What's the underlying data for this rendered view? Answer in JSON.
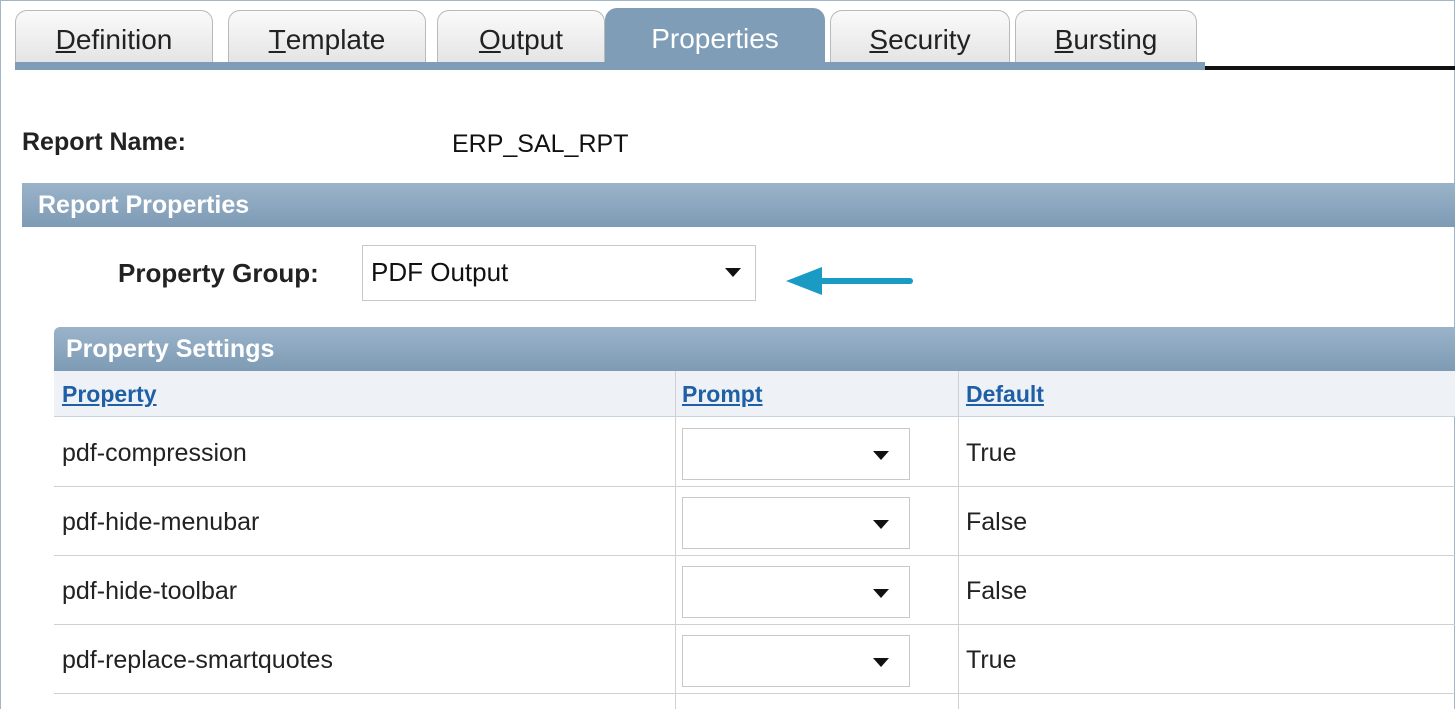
{
  "tabs": [
    {
      "label": "Definition",
      "accel": "D",
      "rest": "efinition",
      "active": false
    },
    {
      "label": "Template",
      "accel": "T",
      "rest": "emplate",
      "active": false
    },
    {
      "label": "Output",
      "accel": "O",
      "rest": "utput",
      "active": false
    },
    {
      "label": "Properties",
      "accel": "",
      "rest": "Properties",
      "active": true
    },
    {
      "label": "Security",
      "accel": "S",
      "rest": "ecurity",
      "active": false
    },
    {
      "label": "Bursting",
      "accel": "B",
      "rest": "ursting",
      "active": false
    }
  ],
  "report": {
    "name_label": "Report Name:",
    "name_value": "ERP_SAL_RPT"
  },
  "report_properties": {
    "header": "Report Properties",
    "property_group_label": "Property Group:",
    "property_group_value": "PDF Output"
  },
  "property_settings": {
    "header": "Property Settings",
    "columns": [
      "Property",
      "Prompt",
      "Default"
    ],
    "rows": [
      {
        "property": "pdf-compression",
        "prompt": "",
        "default": "True"
      },
      {
        "property": "pdf-hide-menubar",
        "prompt": "",
        "default": "False"
      },
      {
        "property": "pdf-hide-toolbar",
        "prompt": "",
        "default": "False"
      },
      {
        "property": "pdf-replace-smartquotes",
        "prompt": "",
        "default": "True"
      }
    ]
  },
  "colors": {
    "accent": "#7f9db7",
    "link": "#1f5fa6",
    "annotation_arrow": "#1a9bc4"
  }
}
